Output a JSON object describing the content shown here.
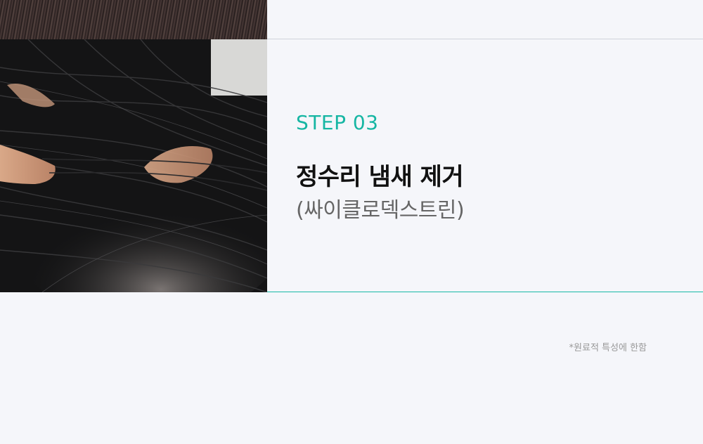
{
  "step_label": "STEP 03",
  "title": "정수리 냄새 제거",
  "subtitle": "(싸이클로덱스트린)",
  "footnote": "*원료적 특성에 한함",
  "colors": {
    "accent": "#16b6a3",
    "background": "#f5f6fa"
  },
  "images": [
    "hair-texture-photo",
    "scalp-hair-photo"
  ]
}
